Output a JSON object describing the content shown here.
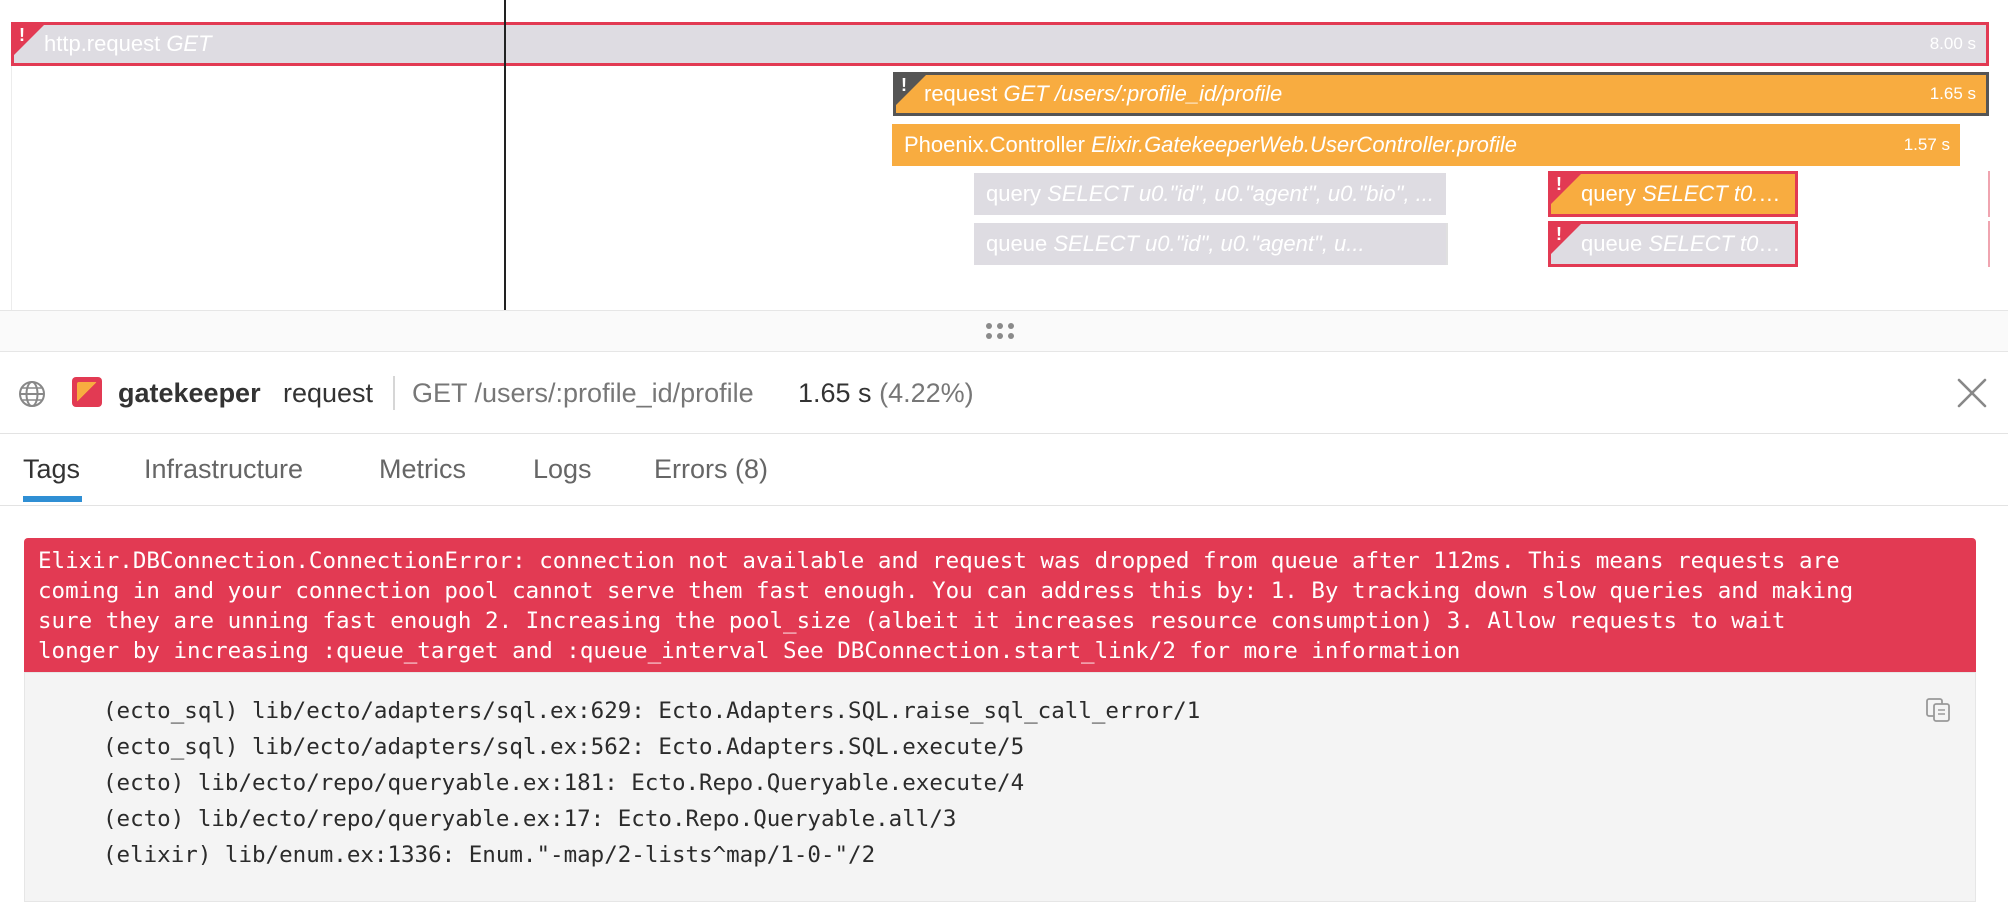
{
  "flame": {
    "spans": [
      {
        "op": "http.request",
        "res": "GET",
        "dur": "8.00 s"
      },
      {
        "op": "request",
        "res": "GET /users/:profile_id/profile",
        "dur": "1.65 s"
      },
      {
        "op": "Phoenix.Controller",
        "res": "Elixir.GatekeeperWeb.UserController.profile",
        "dur": "1.57 s"
      },
      {
        "op": "query",
        "res": "SELECT u0.\"id\", u0.\"agent\", u0.\"bio\", ...",
        "dur": ""
      },
      {
        "op": "queue",
        "res": "SELECT u0.\"id\", u0.\"agent\", u...",
        "dur": ""
      },
      {
        "op": "query",
        "res": "SELECT t0.\"i...",
        "dur": ""
      },
      {
        "op": "queue",
        "res": "SELECT t0.\"i...",
        "dur": ""
      }
    ],
    "error_mark": "!"
  },
  "header": {
    "service": "gatekeeper",
    "operation": "request",
    "resource": "GET /users/:profile_id/profile",
    "duration": "1.65 s",
    "percent": "(4.22%)"
  },
  "tabs": [
    "Tags",
    "Infrastructure",
    "Metrics",
    "Logs",
    "Errors (8)"
  ],
  "error": {
    "message": "Elixir.DBConnection.ConnectionError: connection not available and request was dropped from queue after 112ms. This means requests are\ncoming in and your connection pool cannot serve them fast enough. You can address this by: 1. By tracking down slow queries and making\nsure they are unning fast enough 2. Increasing the pool_size (albeit it increases resource consumption) 3. Allow requests to wait\nlonger by increasing :queue_target and :queue_interval See DBConnection.start_link/2 for more information",
    "stack": "(ecto_sql) lib/ecto/adapters/sql.ex:629: Ecto.Adapters.SQL.raise_sql_call_error/1\n(ecto_sql) lib/ecto/adapters/sql.ex:562: Ecto.Adapters.SQL.execute/5\n(ecto) lib/ecto/repo/queryable.ex:181: Ecto.Repo.Queryable.execute/4\n(ecto) lib/ecto/repo/queryable.ex:17: Ecto.Repo.Queryable.all/3\n(elixir) lib/enum.ex:1336: Enum.\"-map/2-lists^map/1-0-\"/2"
  },
  "icons": {
    "globe": "globe-icon",
    "service": "service-icon",
    "close": "close-icon",
    "copy": "copy-icon",
    "grip": "drag-handle-icon"
  },
  "colors": {
    "error": "#e23a53",
    "span_orange": "#f8ac40",
    "span_grey": "#dedce2",
    "tab_active": "#2f8fd4"
  }
}
